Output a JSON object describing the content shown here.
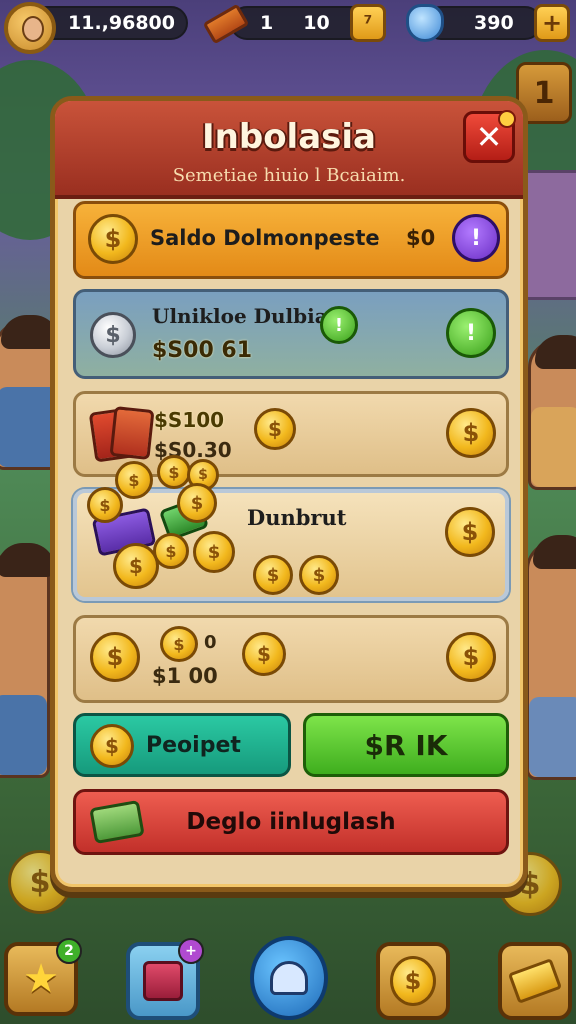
{
  "topbar": {
    "coins_value": "11.,96800",
    "tickets_count": "1",
    "tickets_max": "10",
    "gems_value": "390",
    "plus_label": "+",
    "side_tab_label": "1"
  },
  "panel": {
    "title": "Inbolasia",
    "subtitle": "Semetiae hiuio l Bcaiaim.",
    "close_label": "✕"
  },
  "rows": {
    "saldo_label": "Saldo Dolmonpeste",
    "saldo_value": "$0",
    "saldo_button_glyph": "!",
    "blue_title": "Ulnikloe Dulbiat",
    "blue_amount": "$S00 61",
    "blue_button_glyph": "!",
    "tan_amount_1": "$S100",
    "tan_amount_2": "$S0.30",
    "select_title": "Dunbrut",
    "tan2_amount": "$1 00",
    "coin_glyph": "$",
    "zero_label": "0"
  },
  "buttons": {
    "teal_label": "Peoipet",
    "green_label": "$R IK",
    "red_label": "Deglo iinluglash"
  },
  "bottombar": {
    "star_badge": "2",
    "shop_badge": "+"
  },
  "colors": {
    "panel_bg": "#e9d3a8",
    "header_red": "#c9533a",
    "coin_gold": "#f2b81d",
    "teal": "#2bc9a3",
    "green": "#7ee44a",
    "red": "#ee5d50"
  }
}
